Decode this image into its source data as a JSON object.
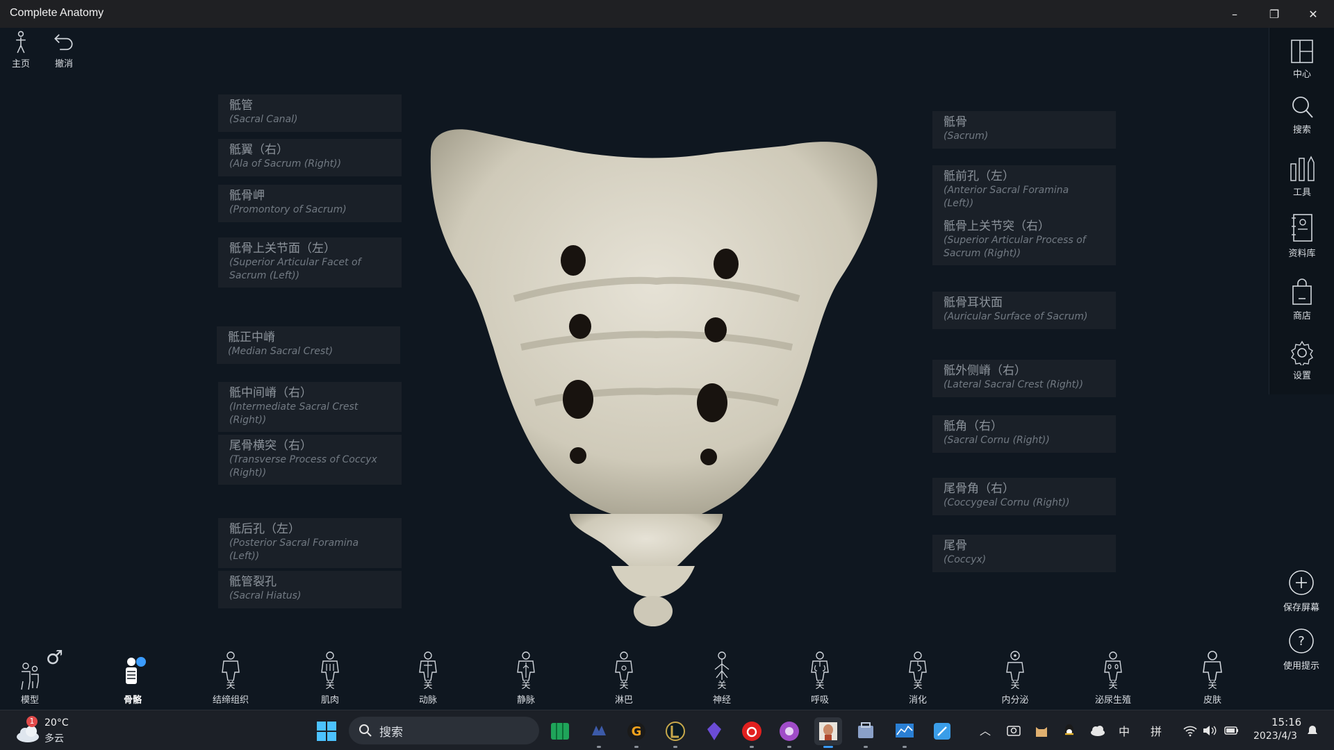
{
  "app": {
    "title": "Complete Anatomy"
  },
  "window_controls": {
    "minimize": "–",
    "restore": "❐",
    "close": "✕"
  },
  "top_tools": [
    {
      "label": "主页",
      "icon": "home-person-icon"
    },
    {
      "label": "撤消",
      "icon": "undo-icon"
    }
  ],
  "right_rail": [
    {
      "label": "中心",
      "icon": "layout-icon"
    },
    {
      "label": "搜索",
      "icon": "search-icon"
    },
    {
      "label": "工具",
      "icon": "tools-icon"
    },
    {
      "label": "资料库",
      "icon": "library-icon"
    },
    {
      "label": "商店",
      "icon": "shop-icon"
    },
    {
      "label": "设置",
      "icon": "settings-icon"
    }
  ],
  "side_actions": [
    {
      "label": "保存屏幕",
      "icon": "plus-circle-icon"
    },
    {
      "label": "使用提示",
      "icon": "help-circle-icon"
    }
  ],
  "labels_left": [
    {
      "zh": "骶管",
      "en": "(Sacral Canal)"
    },
    {
      "zh": "骶翼（右）",
      "en": "(Ala of Sacrum (Right))"
    },
    {
      "zh": "骶骨岬",
      "en": "(Promontory of Sacrum)"
    },
    {
      "zh": "骶骨上关节面（左）",
      "en": "(Superior Articular Facet of",
      "en2": "Sacrum (Left))"
    },
    {
      "zh": "骶正中嵴",
      "en": "(Median Sacral Crest)"
    },
    {
      "zh": "骶中间嵴（右）",
      "en": "(Intermediate Sacral Crest",
      "en2": "(Right))"
    },
    {
      "zh": "尾骨横突（右）",
      "en": "(Transverse Process of Coccyx",
      "en2": "(Right))"
    },
    {
      "zh": "骶后孔（左）",
      "en": "(Posterior Sacral Foramina",
      "en2": "(Left))"
    },
    {
      "zh": "骶管裂孔",
      "en": "(Sacral Hiatus)"
    }
  ],
  "labels_right": [
    {
      "zh": "骶骨",
      "en": "(Sacrum)"
    },
    {
      "zh": "骶前孔（左）",
      "en": "(Anterior Sacral Foramina",
      "en2": "(Left))"
    },
    {
      "zh": "骶骨上关节突（右）",
      "en": "(Superior Articular Process of",
      "en2": "Sacrum (Right))"
    },
    {
      "zh": "骶骨耳状面",
      "en": "(Auricular Surface of Sacrum)"
    },
    {
      "zh": "骶外侧嵴（右）",
      "en": "(Lateral Sacral Crest (Right))"
    },
    {
      "zh": "骶角（右）",
      "en": "(Sacral Cornu (Right))"
    },
    {
      "zh": "尾骨角（右）",
      "en": "(Coccygeal Cornu (Right))"
    },
    {
      "zh": "尾骨",
      "en": "(Coccyx)"
    }
  ],
  "systems": [
    {
      "label": "模型",
      "sub": "",
      "active": false
    },
    {
      "label": "骨骼",
      "sub": "",
      "active": true
    },
    {
      "label": "结缔组织",
      "sub": "关",
      "active": false
    },
    {
      "label": "肌肉",
      "sub": "关",
      "active": false
    },
    {
      "label": "动脉",
      "sub": "关",
      "active": false
    },
    {
      "label": "静脉",
      "sub": "关",
      "active": false
    },
    {
      "label": "淋巴",
      "sub": "关",
      "active": false
    },
    {
      "label": "神经",
      "sub": "关",
      "active": false
    },
    {
      "label": "呼吸",
      "sub": "关",
      "active": false
    },
    {
      "label": "消化",
      "sub": "关",
      "active": false
    },
    {
      "label": "内分泌",
      "sub": "关",
      "active": false
    },
    {
      "label": "泌尿生殖",
      "sub": "关",
      "active": false
    },
    {
      "label": "皮肤",
      "sub": "关",
      "active": false
    }
  ],
  "gender_symbol": "♂",
  "taskbar": {
    "weather_temp": "20°C",
    "weather_desc": "多云",
    "weather_badge": "1",
    "search_placeholder": "搜索",
    "ime_lang": "中",
    "ime_mode": "拼",
    "time": "15:16",
    "date": "2023/4/3"
  }
}
